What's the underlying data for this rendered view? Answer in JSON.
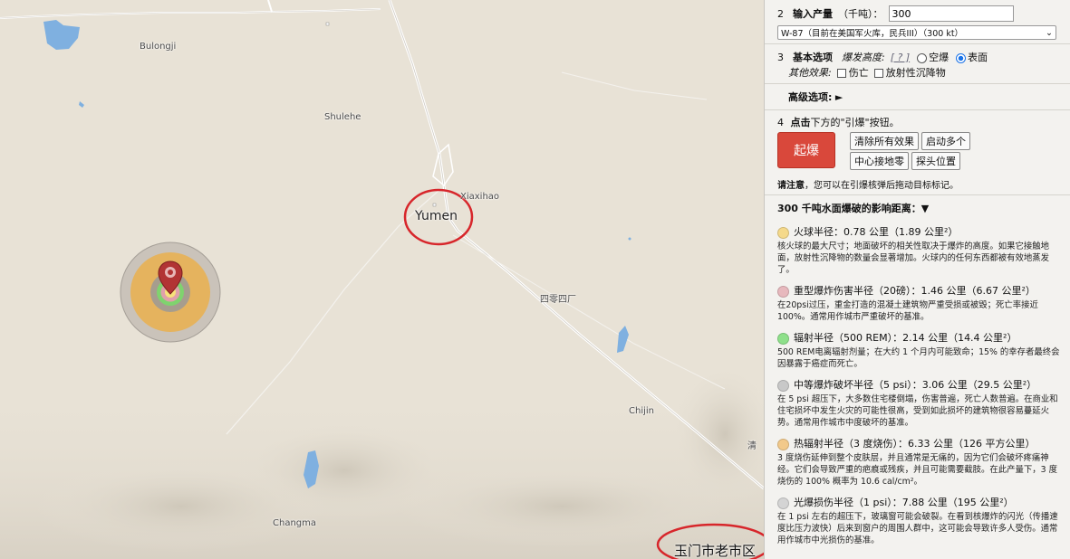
{
  "map": {
    "labels": {
      "bulongji": "Bulongji",
      "shulehe": "Shulehe",
      "xiaxihao": "Xiaxihao",
      "yumen": "Yumen",
      "factory404": "四零四厂",
      "chijin": "Chijin",
      "changma": "Changma",
      "qing": "清",
      "yumen_old": "玉门市老市区"
    }
  },
  "panel": {
    "step2": {
      "number": "2",
      "label": "输入产量",
      "unit": "（千吨）：",
      "yield_value": "300",
      "preset_selected": "W-87（目前在美国军火库，民兵III）（300 kt）"
    },
    "step3": {
      "number": "3",
      "label": "基本选项",
      "burst_label": "爆发高度:",
      "help": "[ ? ]",
      "airburst": "空爆",
      "surface": "表面",
      "other_label": "其他效果:",
      "casualties": "伤亡",
      "fallout": "放射性沉降物"
    },
    "advanced": {
      "label": "高级选项:",
      "arrow": "►"
    },
    "step4": {
      "number": "4",
      "click": "点击",
      "rest": "下方的\"引爆\"按钮。",
      "detonate": "起爆",
      "clear": "清除所有效果",
      "multi": "启动多个",
      "center": "中心接地零",
      "probe": "探头位置"
    },
    "note": {
      "bold": "请注意",
      "text": "，您可以在引爆核弹后拖动目标标记。"
    },
    "effects_header": "300 千吨水面爆破的影响距离：▼",
    "effects": [
      {
        "color": "#f5d98a",
        "title": "火球半径：0.78 公里（1.89 公里²）",
        "desc": "核火球的最大尺寸；地面破坏的相关性取决于爆炸的高度。如果它接触地面，放射性沉降物的数量会显著增加。火球内的任何东西都被有效地蒸发了。"
      },
      {
        "color": "#e7b8bd",
        "title": "重型爆炸伤害半径（20磅）：1.46 公里（6.67 公里²）",
        "desc": "在20psi过压，重金打造的混凝土建筑物严重受损或被毁；死亡率接近100%。通常用作城市严重破坏的基准。"
      },
      {
        "color": "#8ee08a",
        "title": "辐射半径（500 REM）：2.14 公里（14.4 公里²）",
        "desc": "500 REM电离辐射剂量；在大约 1 个月内可能致命；15% 的幸存者最终会因暴露于癌症而死亡。"
      },
      {
        "color": "#c8c8c8",
        "title": "中等爆炸破坏半径（5 psi）：3.06 公里（29.5 公里²）",
        "desc": "在 5 psi 超压下，大多数住宅楼倒塌，伤害普遍，死亡人数普遍。在商业和住宅损坏中发生火灾的可能性很高，受到如此损坏的建筑物很容易蔓延火势。通常用作城市中度破坏的基准。"
      },
      {
        "color": "#f2c98a",
        "title": "热辐射半径（3 度烧伤）：6.33 公里（126 平方公里）",
        "desc": "3 度烧伤延伸到整个皮肤层，并且通常是无痛的，因为它们会破坏疼痛神经。它们会导致严重的疤痕或残疾，并且可能需要截肢。在此产量下，3 度烧伤的 100% 概率为 10.6 cal/cm²。"
      },
      {
        "color": "#d4d4d4",
        "title": "光爆损伤半径（1 psi）：7.88 公里（195 公里²）",
        "desc": "在 1 psi 左右的超压下，玻璃窗可能会破裂。在看到核爆炸的闪光（传播速度比压力波快）后来到窗户的周围人群中，这可能会导致许多人受伤。通常用作城市中光损伤的基准。"
      }
    ]
  }
}
